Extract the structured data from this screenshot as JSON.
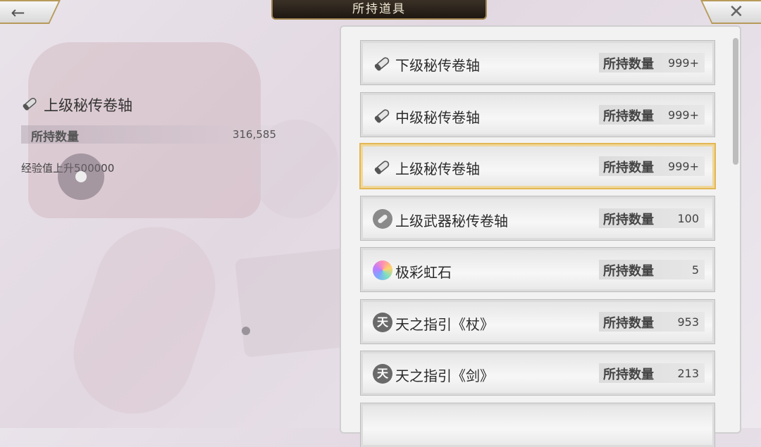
{
  "header": {
    "title": "所持道具"
  },
  "detail": {
    "name": "上级秘传卷轴",
    "count_label": "所持数量",
    "count_value": "316,585",
    "description": "经验值上升500000"
  },
  "items": [
    {
      "name": "下级秘传卷轴",
      "qty_label": "所持数量",
      "qty": "999+",
      "icon": "scroll-icon"
    },
    {
      "name": "中级秘传卷轴",
      "qty_label": "所持数量",
      "qty": "999+",
      "icon": "scroll-icon"
    },
    {
      "name": "上级秘传卷轴",
      "qty_label": "所持数量",
      "qty": "999+",
      "icon": "scroll-icon",
      "selected": true
    },
    {
      "name": "上级武器秘传卷轴",
      "qty_label": "所持数量",
      "qty": "100",
      "icon": "weapon-scroll-icon"
    },
    {
      "name": "极彩虹石",
      "qty_label": "所持数量",
      "qty": "5",
      "icon": "gem-icon"
    },
    {
      "name": "天之指引《杖》",
      "qty_label": "所持数量",
      "qty": "953",
      "icon": "guide-icon"
    },
    {
      "name": "天之指引《剑》",
      "qty_label": "所持数量",
      "qty": "213",
      "icon": "guide-icon"
    }
  ],
  "guide_glyph": "天",
  "colors": {
    "selected_border": "#e2b754",
    "title_bg": "#2a221a"
  }
}
